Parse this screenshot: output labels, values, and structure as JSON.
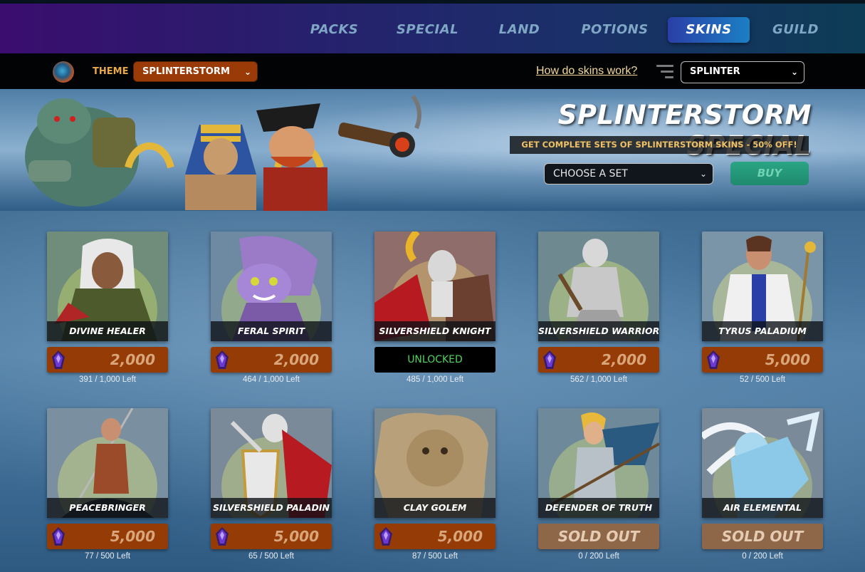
{
  "nav": {
    "items": [
      {
        "label": "PACKS",
        "active": false
      },
      {
        "label": "SPECIAL",
        "active": false
      },
      {
        "label": "LAND",
        "active": false
      },
      {
        "label": "POTIONS",
        "active": false
      },
      {
        "label": "SKINS",
        "active": true
      },
      {
        "label": "GUILD",
        "active": false
      }
    ]
  },
  "themebar": {
    "theme_label": "THEME",
    "theme_value": "SPLINTERSTORM",
    "help_link": "How do skins work?",
    "splinter_value": "SPLINTER"
  },
  "banner": {
    "title": "SPLINTERSTORM SPECIAL",
    "subtitle": "GET COMPLETE SETS OF SPLINTERSTORM SKINS - 50% OFF!",
    "set_select": "CHOOSE A SET",
    "buy_label": "BUY"
  },
  "cards": [
    {
      "name": "DIVINE HEALER",
      "status": "price",
      "price": "2,000",
      "left": "391 / 1,000 Left"
    },
    {
      "name": "FERAL SPIRIT",
      "status": "price",
      "price": "2,000",
      "left": "464 / 1,000 Left"
    },
    {
      "name": "SILVERSHIELD KNIGHT",
      "status": "unlocked",
      "status_label": "UNLOCKED",
      "left": "485 / 1,000 Left"
    },
    {
      "name": "SILVERSHIELD WARRIOR",
      "status": "price",
      "price": "2,000",
      "left": "562 / 1,000 Left"
    },
    {
      "name": "TYRUS PALADIUM",
      "status": "price",
      "price": "5,000",
      "left": "52 / 500 Left"
    },
    {
      "name": "PEACEBRINGER",
      "status": "price",
      "price": "5,000",
      "left": "77 / 500 Left"
    },
    {
      "name": "SILVERSHIELD PALADIN",
      "status": "price",
      "price": "5,000",
      "left": "65 / 500 Left"
    },
    {
      "name": "CLAY GOLEM",
      "status": "price",
      "price": "5,000",
      "left": "87 / 500 Left"
    },
    {
      "name": "DEFENDER OF TRUTH",
      "status": "soldout",
      "status_label": "SOLD OUT",
      "left": "0 / 200 Left"
    },
    {
      "name": "AIR ELEMENTAL",
      "status": "soldout",
      "status_label": "SOLD OUT",
      "left": "0 / 200 Left"
    }
  ],
  "colors": {
    "price_bg": "#953c06",
    "soldout_bg": "#8e6749",
    "unlocked_text": "#4dd35e",
    "nav_active": "#1b7fc4"
  }
}
